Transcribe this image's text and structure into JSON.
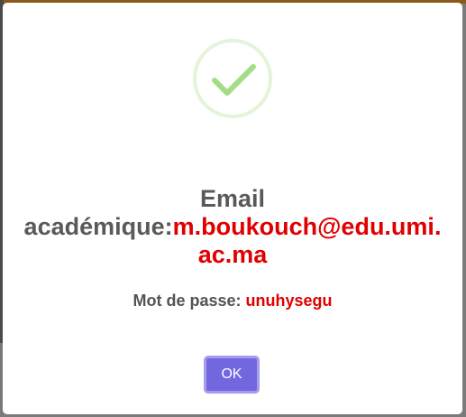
{
  "dialog": {
    "icon": "success-check-icon",
    "title_label": "Email académique:",
    "title_value": "m.boukouch@edu.umi.ac.ma",
    "password_label": "Mot de passe:",
    "password_value": "unuhysegu",
    "ok_label": "OK"
  },
  "colors": {
    "accent_value": "#e00000",
    "button": "#7367e0",
    "success": "#a5dc86",
    "text": "#595959"
  }
}
